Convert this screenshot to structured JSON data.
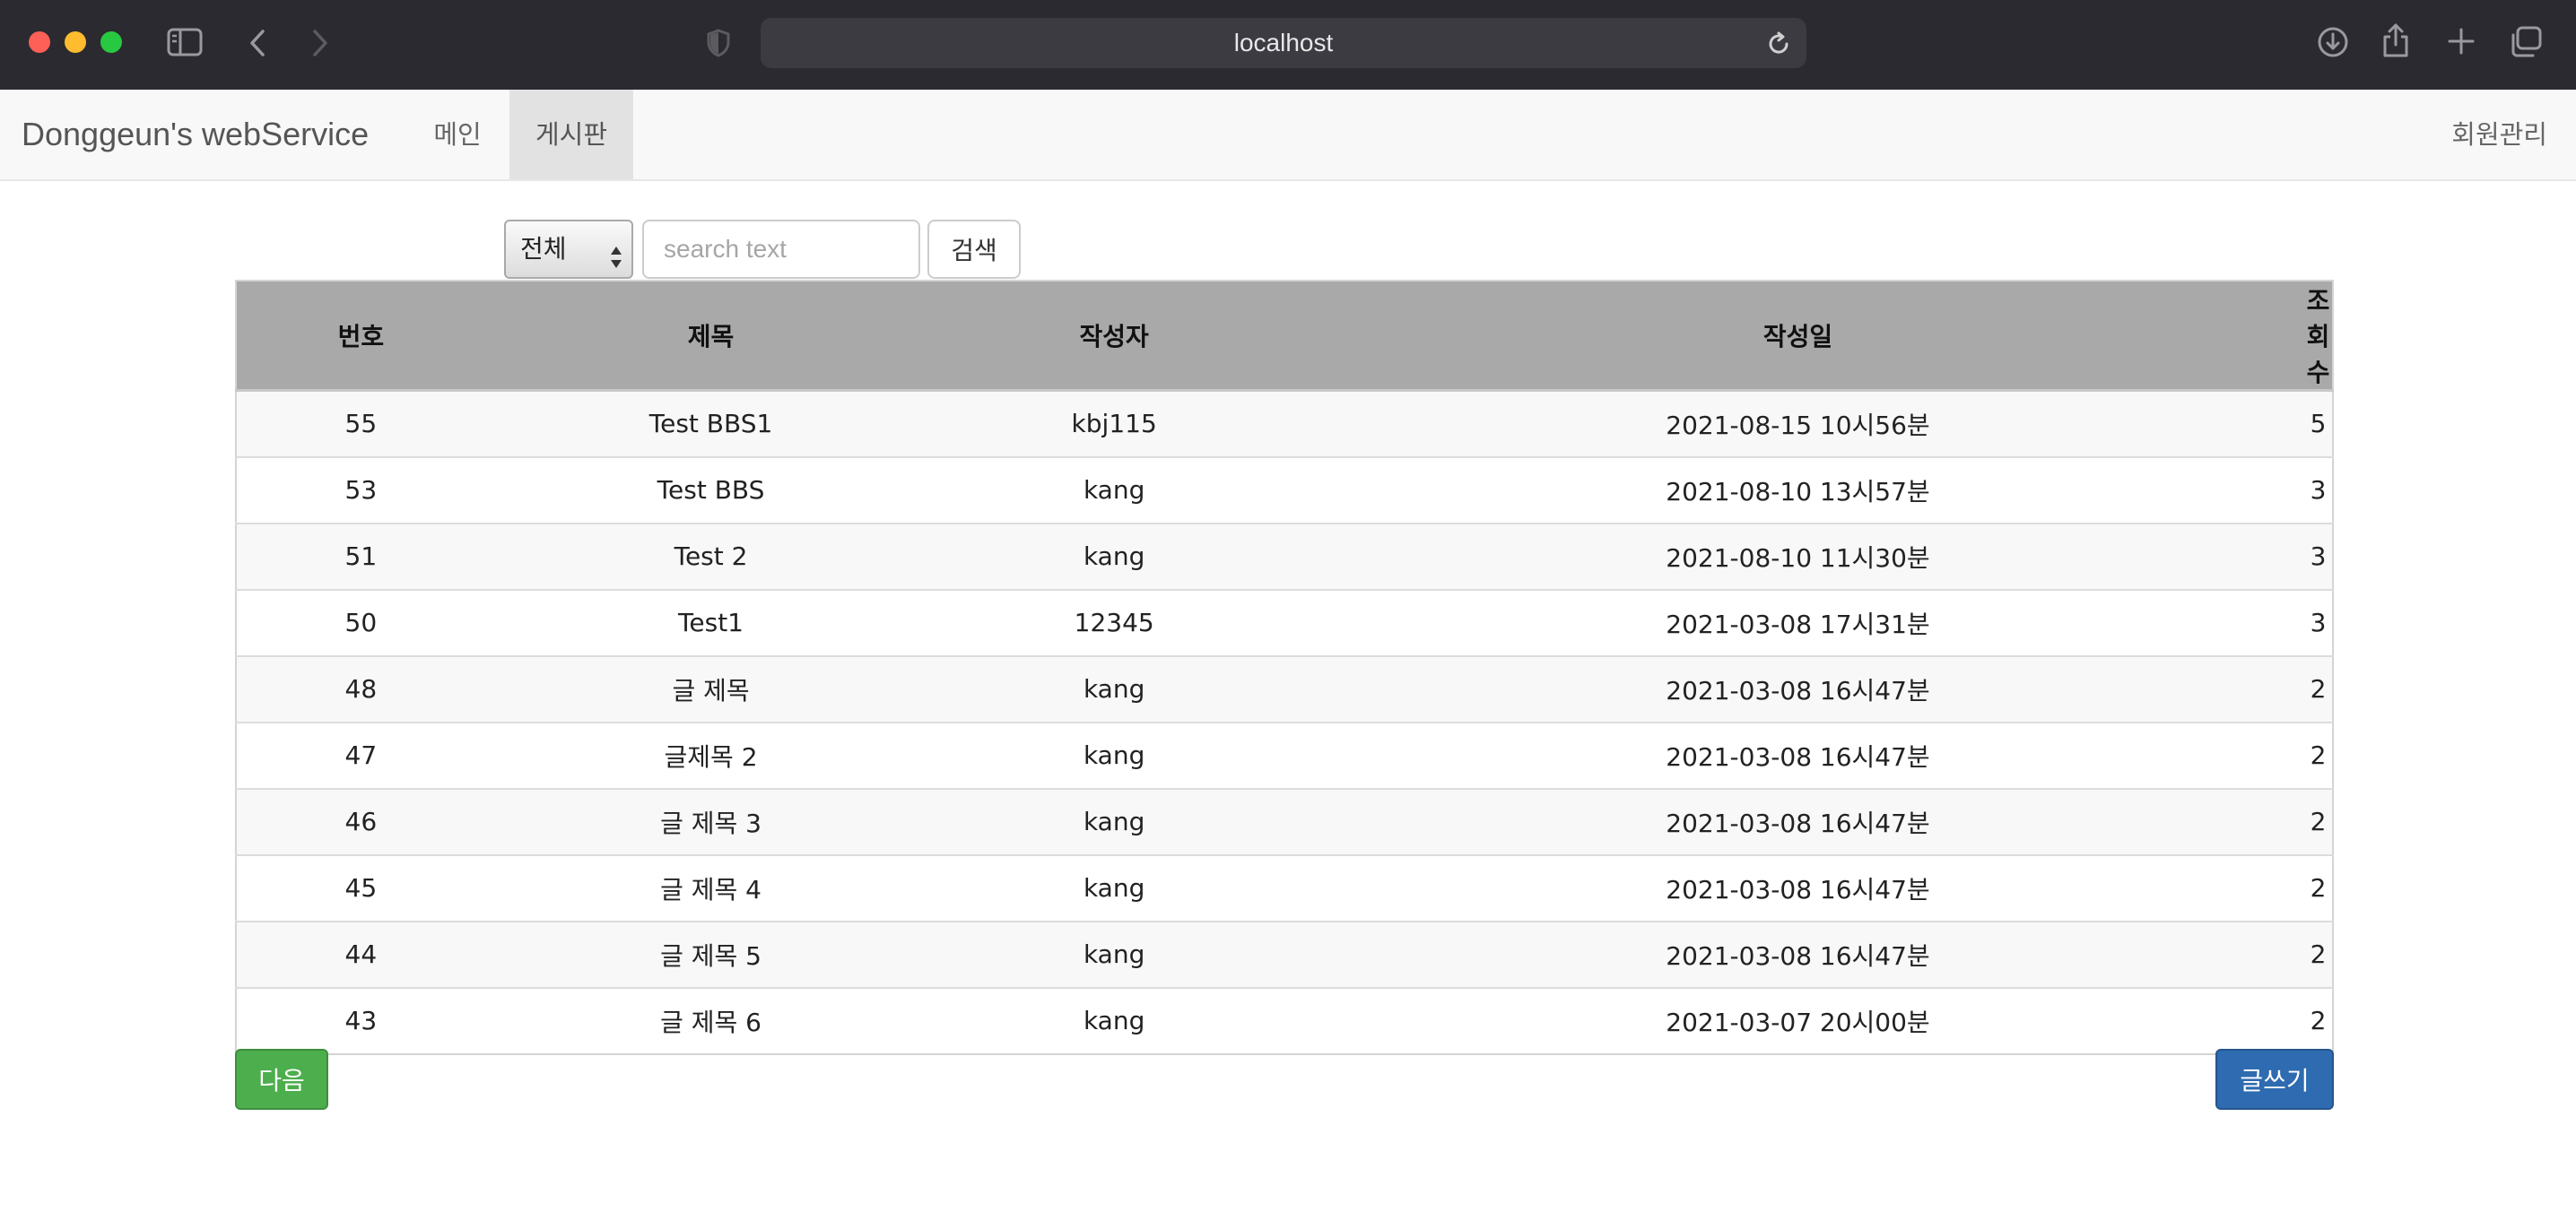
{
  "browser": {
    "url": "localhost"
  },
  "navbar": {
    "brand": "Donggeun's webService",
    "items": [
      {
        "label": "메인"
      },
      {
        "label": "게시판"
      }
    ],
    "right_item": "회원관리"
  },
  "search": {
    "select_value": "전체",
    "placeholder": "search text",
    "button_label": "검색"
  },
  "table": {
    "headers": [
      "번호",
      "제목",
      "작성자",
      "작성일",
      "조회수"
    ],
    "rows": [
      [
        "55",
        "Test BBS1",
        "kbj115",
        "2021-08-15 10시56분",
        "5"
      ],
      [
        "53",
        "Test BBS",
        "kang",
        "2021-08-10 13시57분",
        "3"
      ],
      [
        "51",
        "Test 2",
        "kang",
        "2021-08-10 11시30분",
        "3"
      ],
      [
        "50",
        "Test1",
        "12345",
        "2021-03-08 17시31분",
        "3"
      ],
      [
        "48",
        "글 제목",
        "kang",
        "2021-03-08 16시47분",
        "2"
      ],
      [
        "47",
        "글제목 2",
        "kang",
        "2021-03-08 16시47분",
        "2"
      ],
      [
        "46",
        "글 제목 3",
        "kang",
        "2021-03-08 16시47분",
        "2"
      ],
      [
        "45",
        "글 제목 4",
        "kang",
        "2021-03-08 16시47분",
        "2"
      ],
      [
        "44",
        "글 제목 5",
        "kang",
        "2021-03-08 16시47분",
        "2"
      ],
      [
        "43",
        "글 제목 6",
        "kang",
        "2021-03-07 20시00분",
        "2"
      ]
    ]
  },
  "buttons": {
    "next_label": "다음",
    "write_label": "글쓰기"
  }
}
